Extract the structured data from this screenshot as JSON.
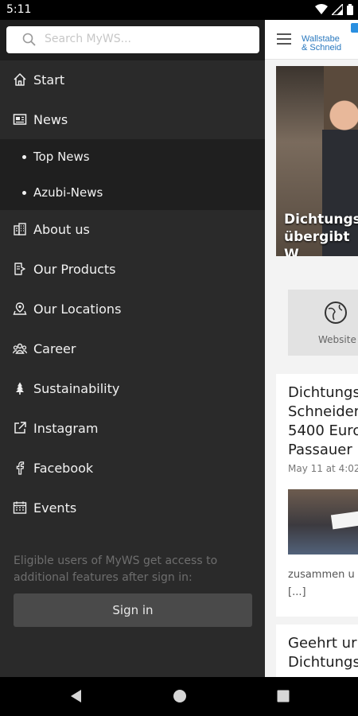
{
  "status_bar": {
    "time": "5:11",
    "icons": [
      "wifi-icon",
      "signal-icon",
      "battery-icon"
    ]
  },
  "drawer": {
    "search": {
      "placeholder": "Search MyWS..."
    },
    "items": [
      {
        "label": "Start",
        "icon": "home-icon"
      },
      {
        "label": "News",
        "icon": "newspaper-icon"
      },
      {
        "label": "About us",
        "icon": "building-icon"
      },
      {
        "label": "Our Products",
        "icon": "product-tag-icon"
      },
      {
        "label": "Our Locations",
        "icon": "location-icon"
      },
      {
        "label": "Career",
        "icon": "people-icon"
      },
      {
        "label": "Sustainability",
        "icon": "tree-icon"
      },
      {
        "label": "Instagram",
        "icon": "external-link-icon"
      },
      {
        "label": "Facebook",
        "icon": "facebook-icon"
      },
      {
        "label": "Events",
        "icon": "calendar-icon"
      }
    ],
    "news_sub_items": [
      {
        "label": "Top News"
      },
      {
        "label": "Azubi-News"
      }
    ],
    "signin_note": "Eligible users of MyWS get access to additional features after sign in:",
    "signin_button": "Sign in"
  },
  "background_app": {
    "brand_lines": "Wallstabe\n& Schneid",
    "hero_caption": "Dichtungs\nübergibt W",
    "website_label": "Website",
    "article": {
      "title": "Dichtungs\nSchneider\n5400 Euro\nPassauer",
      "date": "May 11 at 4:02",
      "excerpt": "zusammen u\n[...]"
    },
    "article2": {
      "title": "Geehrt ur\nDichtungs"
    }
  },
  "colors": {
    "drawer_bg": "#2a2a2a",
    "submenu_bg": "#1f1f1f",
    "brand_blue": "#2a79bf"
  }
}
